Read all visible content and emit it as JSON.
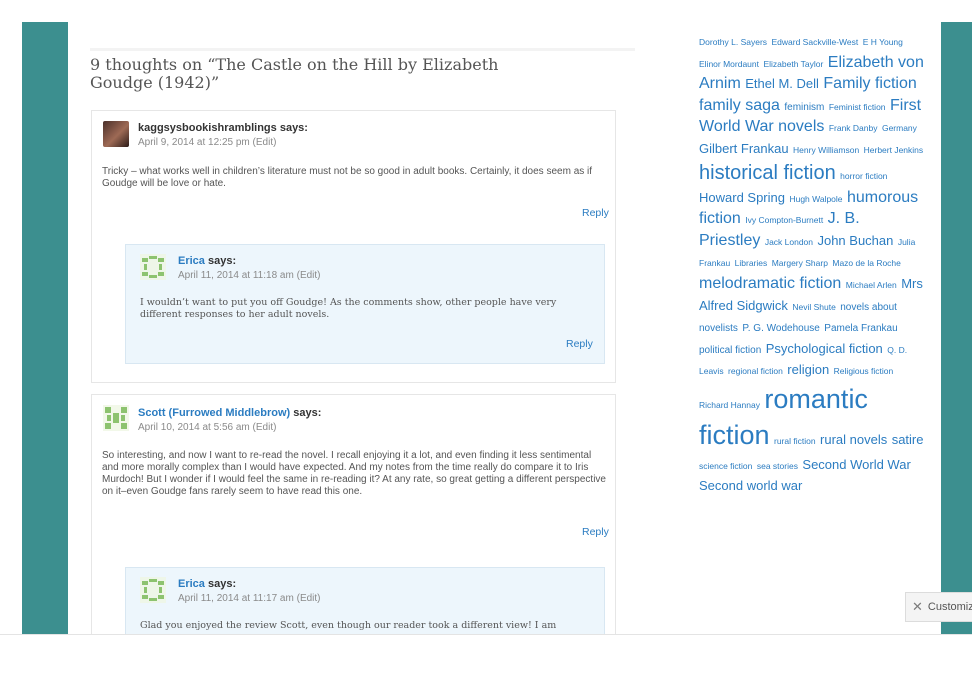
{
  "comments_title": "9 thoughts on “The Castle on the Hill by Elizabeth Goudge (1942)”",
  "comments": [
    {
      "author": "kaggsysbookishramblings",
      "says": "says:",
      "date": "April 9, 2014 at 12:25 pm",
      "edit": "(Edit)",
      "text": "Tricky – what works well in children’s literature must not be so good in adult books. Certainly, it does seem as if Goudge will be love or hate.",
      "reply": "Reply",
      "child": {
        "author": "Erica",
        "says": "says:",
        "date": "April 11, 2014 at 11:18 am",
        "edit": "(Edit)",
        "text": "I wouldn’t want to put you off Goudge! As the comments show, other people have very different responses to her adult novels.",
        "reply": "Reply"
      }
    },
    {
      "author": "Scott (Furrowed Middlebrow)",
      "says": "says:",
      "date": "April 10, 2014 at 5:56 am",
      "edit": "(Edit)",
      "text": "So interesting, and now I want to re-read the novel. I recall enjoying it a lot, and even finding it less sentimental and more morally complex than I would have expected. And my notes from the time really do compare it to Iris Murdoch! But I wonder if I would feel the same in re-reading it? At any rate, so great getting a different perspective on it–even Goudge fans rarely seem to have read this one.",
      "reply": "Reply",
      "child": {
        "author": "Erica",
        "says": "says:",
        "date": "April 11, 2014 at 11:17 am",
        "edit": "(Edit)",
        "text": "Glad you enjoyed the review Scott, even though our reader took a different view! I am"
      }
    }
  ],
  "tags": [
    {
      "label": "Dorothy L. Sayers",
      "size": "xs"
    },
    {
      "label": "Edward Sackville-West",
      "size": "xs"
    },
    {
      "label": "E H Young",
      "size": "xs"
    },
    {
      "label": "Elinor Mordaunt",
      "size": "xs"
    },
    {
      "label": "Elizabeth Taylor",
      "size": "xs"
    },
    {
      "label": "Elizabeth von Arnim",
      "size": "l"
    },
    {
      "label": "Ethel M. Dell",
      "size": "m"
    },
    {
      "label": "Family fiction",
      "size": "l"
    },
    {
      "label": "family saga",
      "size": "l"
    },
    {
      "label": "feminism",
      "size": "s"
    },
    {
      "label": "Feminist fiction",
      "size": "xs"
    },
    {
      "label": "First World War novels",
      "size": "l"
    },
    {
      "label": "Frank Danby",
      "size": "xs"
    },
    {
      "label": "Germany",
      "size": "xs"
    },
    {
      "label": "Gilbert Frankau",
      "size": "m"
    },
    {
      "label": "Henry Williamson",
      "size": "xs"
    },
    {
      "label": "Herbert Jenkins",
      "size": "xs"
    },
    {
      "label": "historical fiction",
      "size": "xl"
    },
    {
      "label": "horror fiction",
      "size": "xs"
    },
    {
      "label": "Howard Spring",
      "size": "m"
    },
    {
      "label": "Hugh Walpole",
      "size": "xs"
    },
    {
      "label": "humorous fiction",
      "size": "l"
    },
    {
      "label": "Ivy Compton-Burnett",
      "size": "xs"
    },
    {
      "label": "J. B. Priestley",
      "size": "l"
    },
    {
      "label": "Jack London",
      "size": "xs"
    },
    {
      "label": "John Buchan",
      "size": "m"
    },
    {
      "label": "Julia Frankau",
      "size": "xs"
    },
    {
      "label": "Libraries",
      "size": "xs"
    },
    {
      "label": "Margery Sharp",
      "size": "xs"
    },
    {
      "label": "Mazo de la Roche",
      "size": "xs"
    },
    {
      "label": "melodramatic fiction",
      "size": "l"
    },
    {
      "label": "Michael Arlen",
      "size": "xs"
    },
    {
      "label": "Mrs Alfred Sidgwick",
      "size": "m"
    },
    {
      "label": "Nevil Shute",
      "size": "xs"
    },
    {
      "label": "novels about novelists",
      "size": "s"
    },
    {
      "label": "P. G. Wodehouse",
      "size": "s"
    },
    {
      "label": "Pamela Frankau",
      "size": "s"
    },
    {
      "label": "political fiction",
      "size": "s"
    },
    {
      "label": "Psychological fiction",
      "size": "m"
    },
    {
      "label": "Q. D. Leavis",
      "size": "xs"
    },
    {
      "label": "regional fiction",
      "size": "xs"
    },
    {
      "label": "religion",
      "size": "m"
    },
    {
      "label": "Religious fiction",
      "size": "xs"
    },
    {
      "label": "Richard Hannay",
      "size": "xs"
    },
    {
      "label": "romantic fiction",
      "size": "xxl"
    },
    {
      "label": "rural fiction",
      "size": "xs"
    },
    {
      "label": "rural novels",
      "size": "m"
    },
    {
      "label": "satire",
      "size": "m"
    },
    {
      "label": "science fiction",
      "size": "xs"
    },
    {
      "label": "sea stories",
      "size": "xs"
    },
    {
      "label": "Second World War",
      "size": "m"
    },
    {
      "label": "Second world war",
      "size": "m"
    }
  ],
  "customize_label": "Customize",
  "colors": {
    "band": "#3c8f8f",
    "link": "#2b7cc1"
  }
}
